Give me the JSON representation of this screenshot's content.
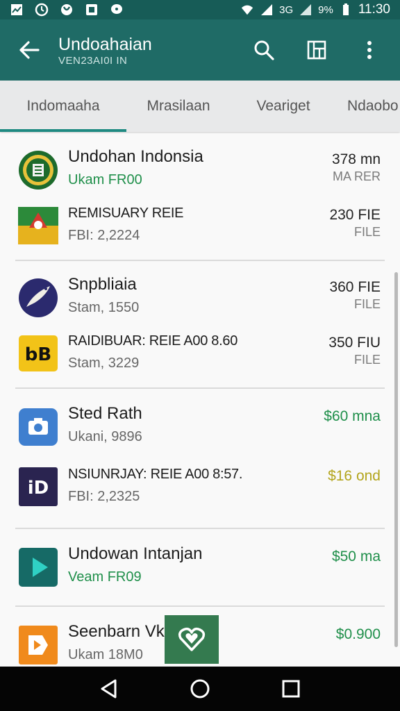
{
  "status_bar": {
    "battery_text": "9%",
    "time": "11:30",
    "network_text": "3G"
  },
  "toolbar": {
    "title": "Undoahaian",
    "subtitle": "VEN23AI0I IN"
  },
  "tabs": [
    {
      "label": "Indomaaha"
    },
    {
      "label": "Mrasilaan"
    },
    {
      "label": "Veariget"
    },
    {
      "label": "Ndaobo"
    }
  ],
  "groups": [
    {
      "rows": [
        {
          "title": "Undohan Indonsia",
          "meta": "Ukam FR00",
          "price": "378 mn",
          "unit": "MA RER",
          "icon": "emblem-icon"
        },
        {
          "title": "REMISUARY REIE",
          "meta": "FBI: 2,2224",
          "price": "230 FIE",
          "unit": "FILE",
          "icon": "flag-emblem-icon"
        }
      ]
    },
    {
      "rows": [
        {
          "title": "Snpbliaia",
          "meta": "Stam, 1550",
          "price": "360 FIE",
          "unit": "FILE",
          "icon": "bird-icon"
        },
        {
          "title": "RAIDIBUAR: REIE A00 8.60",
          "meta": "Stam, 3229",
          "price": "350 FIU",
          "unit": "FILE",
          "icon": "bb-logo-icon"
        }
      ]
    },
    {
      "rows": [
        {
          "title": "Sted Rath",
          "meta": "Ukani, 9896",
          "price": "$60 mna",
          "unit": "",
          "icon": "camera-icon"
        },
        {
          "title": "NSIUNRJAY: REIE A00 8:57.",
          "meta": "FBI: 2,2325",
          "price": "$16 ond",
          "unit": "",
          "icon": "id-logo-icon"
        }
      ]
    },
    {
      "rows": [
        {
          "title": "Undowan Intanjan",
          "meta": "Veam FR09",
          "price": "$50 ma",
          "unit": "",
          "icon": "play-icon"
        },
        {
          "title": "Seenbarn Vk",
          "meta": "Ukam 18M0",
          "price": "$0.900",
          "unit": "",
          "icon": "tag-play-icon"
        }
      ]
    }
  ],
  "colors": {
    "primary": "#1f6b66",
    "status_bar": "#175c57",
    "accent": "#1f8a82",
    "green_text": "#1f8f4a"
  }
}
